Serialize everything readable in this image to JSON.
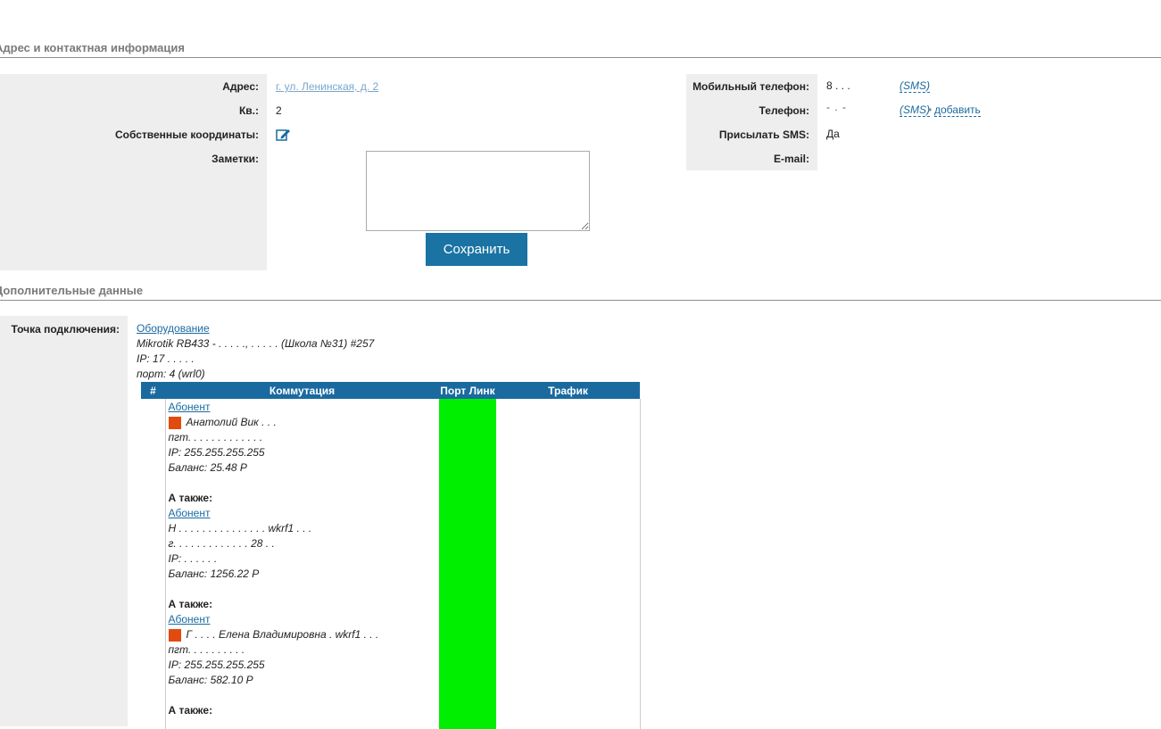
{
  "section_contacts": {
    "title": "Адрес и контактная информация"
  },
  "address": {
    "address_label": "Адрес:",
    "address_value": "г. ул. Ленинская, д. 2",
    "flat_label": "Кв.:",
    "flat_value": "2",
    "coords_label": "Собственные координаты:",
    "notes_label": "Заметки:",
    "notes_value": "",
    "save_label": "Сохранить"
  },
  "contacts": {
    "mobile_label": "Мобильный телефон:",
    "mobile_value": "8 . . .",
    "phone_label": "Телефон:",
    "phone_value": "- . -",
    "sms_link": "(SMS)",
    "sms_link2": "(SMS)",
    "separator": "•",
    "add_link": "добавить",
    "send_sms_label": "Присылать SMS:",
    "send_sms_value": "Да",
    "email_label": "E-mail:",
    "email_value": ""
  },
  "section_extra": {
    "title": "Дополнительные данные"
  },
  "connection": {
    "label": "Точка подключения:",
    "equipment_link": "Оборудование",
    "device_line": "Mikrotik RB433 - . . . . ., . . . . . (Школа №31) #257",
    "ip_line": "IP: 17 . . . . .",
    "port_line": "порт: 4 (wrl0)"
  },
  "table": {
    "headers": [
      "#",
      "Коммутация",
      "Порт Линк",
      "Трафик"
    ],
    "abonents": [
      {
        "link": "Абонент",
        "name": "Анатолий Вик . . .",
        "address": "пгт. . . . . . . . . . . . .",
        "ip": "IP: 255.255.255.255",
        "balance": "Баланс: 25.48 Р",
        "marker": true
      },
      {
        "also": "А также:",
        "link": "Абонент",
        "name": "Н . . . . . . . . . . . . . . . wkrf1 . . .",
        "address": "г. . . . . . . . . . . . . 28 . .",
        "ip": "IP: . . . . . .",
        "balance": "Баланс: 1256.22 Р",
        "marker": false
      },
      {
        "also": "А также:",
        "link": "Абонент",
        "name": "Г . . . . Елена Владимировна . wkrf1 . . .",
        "address": "пгт. . . . . . . . . .",
        "ip": "IP: 255.255.255.255",
        "balance": "Баланс: 582.10 Р",
        "marker": true
      }
    ],
    "also_last": "А также:"
  },
  "colors": {
    "accent": "#1a6aa0",
    "button": "#1a73a3",
    "port_link": "#00ee00",
    "marker": "#e24a10",
    "panel": "#eeeeee"
  }
}
